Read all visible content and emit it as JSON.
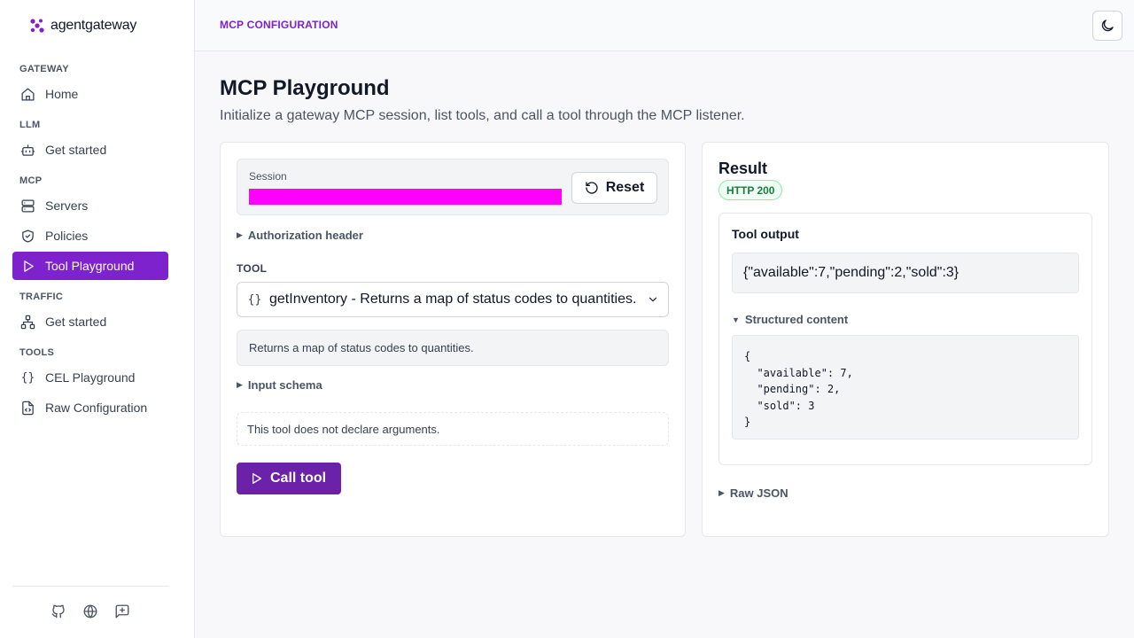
{
  "app": {
    "logo_text": "agentgateway"
  },
  "sidebar": {
    "sections": [
      {
        "label": "GATEWAY",
        "items": [
          {
            "label": "Home",
            "icon": "home-icon"
          }
        ]
      },
      {
        "label": "LLM",
        "items": [
          {
            "label": "Get started",
            "icon": "bot-icon"
          }
        ]
      },
      {
        "label": "MCP",
        "items": [
          {
            "label": "Servers",
            "icon": "server-icon"
          },
          {
            "label": "Policies",
            "icon": "shield-icon"
          },
          {
            "label": "Tool Playground",
            "icon": "play-icon",
            "active": true
          }
        ]
      },
      {
        "label": "TRAFFIC",
        "items": [
          {
            "label": "Get started",
            "icon": "network-icon"
          }
        ]
      },
      {
        "label": "TOOLS",
        "items": [
          {
            "label": "CEL Playground",
            "icon": "braces-icon"
          },
          {
            "label": "Raw Configuration",
            "icon": "file-code-icon"
          }
        ]
      }
    ],
    "footer_icons": [
      "github-icon",
      "globe-icon",
      "feedback-icon"
    ],
    "accent_color": "#7e22ce"
  },
  "header": {
    "title": "MCP CONFIGURATION",
    "theme_icon": "moon-icon"
  },
  "page": {
    "title": "MCP Playground",
    "subtitle": "Initialize a gateway MCP session, list tools, and call a tool through the MCP listener."
  },
  "session": {
    "label": "Session",
    "reset_label": "Reset"
  },
  "auth": {
    "label": "Authorization header"
  },
  "tool": {
    "field_label": "TOOL",
    "selected": "getInventory - Returns a map of status codes to quantities.",
    "description": "Returns a map of status codes to quantities.",
    "input_schema_label": "Input schema",
    "no_args_text": "This tool does not declare arguments.",
    "call_label": "Call tool"
  },
  "result": {
    "title": "Result",
    "status": "HTTP 200",
    "status_color": "#15803d",
    "output_label": "Tool output",
    "output_value": "{\"available\":7,\"pending\":2,\"sold\":3}",
    "structured_label": "Structured content",
    "structured_json": "{\n  \"available\": 7,\n  \"pending\": 2,\n  \"sold\": 3\n}",
    "raw_json_label": "Raw JSON"
  }
}
